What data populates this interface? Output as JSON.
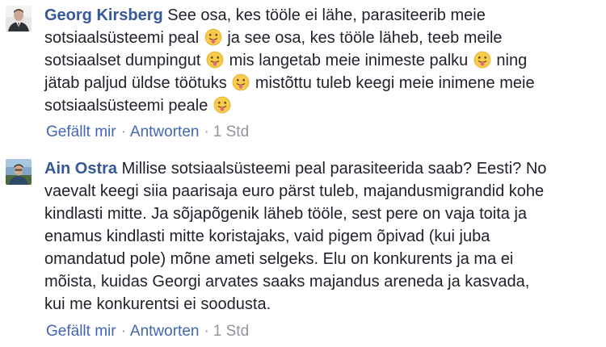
{
  "comments": [
    {
      "author": "Georg Kirsberg",
      "lines": [
        {
          "before": "See osa, kes tööle ei lähe, parasiteerib meie",
          "emoji": false,
          "after": ""
        },
        {
          "before": "sotsiaalsüsteemi peal",
          "emoji": true,
          "after": "ja see osa, kes tööle läheb, teeb meile"
        },
        {
          "before": "sotsiaalset dumpingut",
          "emoji": true,
          "after": "mis langetab meie inimeste palku",
          "emoji2": true,
          "after2": "ning"
        },
        {
          "before": "jätab paljud üldse töötuks",
          "emoji": true,
          "after": "mistõttu tuleb keegi meie inimene meie"
        },
        {
          "before": "sotsiaalsüsteemi peale",
          "emoji": true,
          "after": ""
        }
      ],
      "like_label": "Gefällt mir",
      "reply_label": "Antworten",
      "separator": "·",
      "time": "1 Std"
    },
    {
      "author": "Ain Ostra",
      "lines": [
        {
          "before": "Millise sotsiaalsüsteemi peal parasiteerida saab? Eesti? No"
        },
        {
          "before": "vaevalt keegi siia paarisaja euro pärst tuleb, majandusmigrandid kohe"
        },
        {
          "before": "kindlasti mitte. Ja sõjapõgenik läheb tööle, sest pere on vaja toita ja"
        },
        {
          "before": "enamus kindlasti mitte koristajaks, vaid pigem õpivad (kui juba"
        },
        {
          "before": "omandatud pole) mõne ameti selgeks. Elu on konkurents ja ma ei"
        },
        {
          "before": "mõista, kuidas Georgi arvates saaks majandus areneda ja kasvada,"
        },
        {
          "before": "kui me konkurentsi ei soodusta."
        }
      ],
      "like_label": "Gefällt mir",
      "reply_label": "Antworten",
      "separator": "·",
      "time": "1 Std"
    }
  ],
  "emoji_name": "tongue-out-emoji",
  "colors": {
    "author": "#365899",
    "text": "#1d2129",
    "link": "#4267b2",
    "meta": "#90949c"
  }
}
